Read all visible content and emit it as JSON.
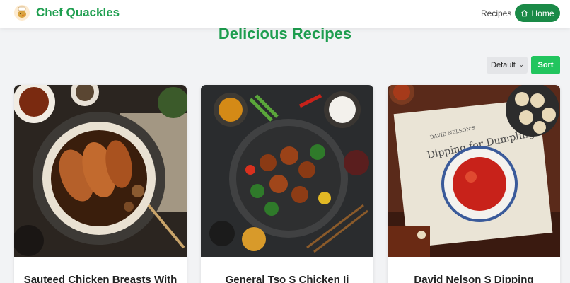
{
  "header": {
    "brand": "Chef Quackles",
    "logo_icon": "duck-chef-icon",
    "nav_recipes": "Recipes",
    "home_label": "Home",
    "home_icon": "home-icon"
  },
  "main": {
    "title": "Delicious Recipes",
    "sort": {
      "selected": "Default",
      "button_label": "Sort"
    }
  },
  "recipes": [
    {
      "title": "Sauteed Chicken Breasts With",
      "image": "chicken-breast-dish-image"
    },
    {
      "title": "General Tso S Chicken Ii",
      "image": "general-tso-chicken-image"
    },
    {
      "title": "David Nelson S Dipping",
      "image": "dipping-sauce-dumplings-image"
    }
  ],
  "colors": {
    "brand_green": "#1e9e4f",
    "home_button": "#1a8a47",
    "sort_button": "#22c55e",
    "background": "#f2f3f5"
  }
}
